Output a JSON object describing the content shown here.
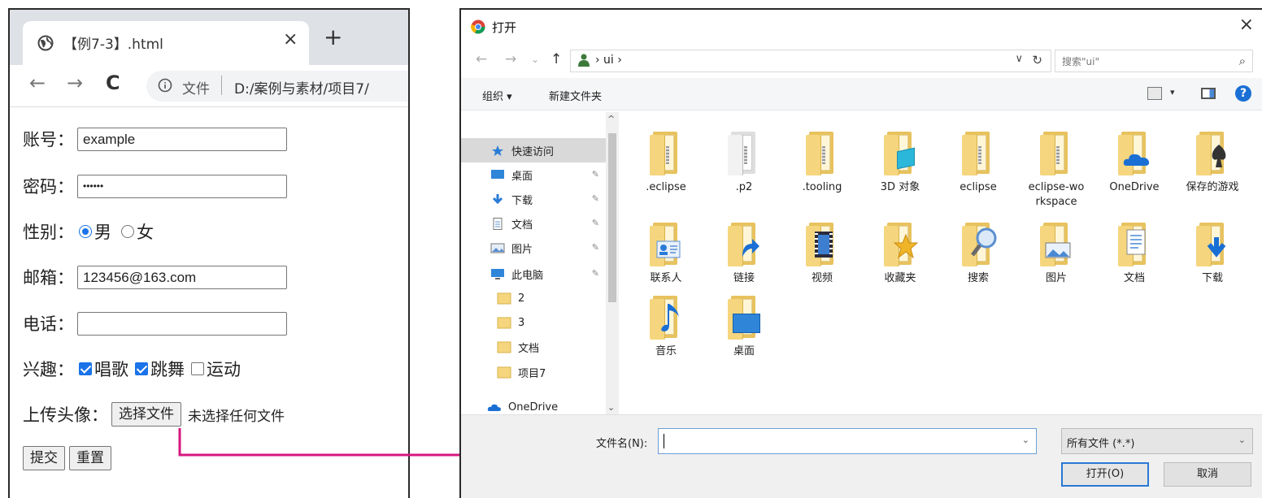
{
  "browser": {
    "tab_title": "【例7-3】.html",
    "tab_close": "×",
    "new_tab": "+",
    "nav": {
      "back": "←",
      "forward": "→",
      "reload": "C"
    },
    "address": {
      "scheme": "文件",
      "url": "D:/案例与素材/项目7/"
    }
  },
  "form": {
    "account": {
      "label": "账号：",
      "value": "example"
    },
    "password": {
      "label": "密码：",
      "value": "••••••"
    },
    "gender": {
      "label": "性别：",
      "options": [
        {
          "label": "男",
          "checked": true
        },
        {
          "label": "女",
          "checked": false
        }
      ]
    },
    "email": {
      "label": "邮箱：",
      "value": "123456@163.com"
    },
    "phone": {
      "label": "电话：",
      "value": ""
    },
    "hobby": {
      "label": "兴趣：",
      "options": [
        {
          "label": "唱歌",
          "checked": true
        },
        {
          "label": "跳舞",
          "checked": true
        },
        {
          "label": "运动",
          "checked": false
        }
      ]
    },
    "avatar": {
      "label": "上传头像：",
      "button": "选择文件",
      "status": "未选择任何文件"
    },
    "submit": "提交",
    "reset": "重置"
  },
  "dialog": {
    "title": "打开",
    "close": "×",
    "nav": {
      "back": "←",
      "forward": "→",
      "recent": "⌄",
      "up": "↑"
    },
    "breadcrumb": "› ui ›",
    "address_dropdown": "∨",
    "refresh": "↻",
    "search_placeholder": "搜索\"ui\"",
    "search_icon": "⌕",
    "toolbar": {
      "organize": "组织 ▾",
      "new_folder": "新建文件夹",
      "view_dropdown": "▾",
      "help": "?"
    },
    "nav_pane": [
      {
        "label": "快速访问",
        "icon": "star-icon",
        "selected": true,
        "pinned": false
      },
      {
        "label": "桌面",
        "icon": "desktop-icon",
        "selected": false,
        "pinned": true
      },
      {
        "label": "下载",
        "icon": "download-icon",
        "selected": false,
        "pinned": true
      },
      {
        "label": "文档",
        "icon": "document-icon",
        "selected": false,
        "pinned": true
      },
      {
        "label": "图片",
        "icon": "picture-icon",
        "selected": false,
        "pinned": true
      },
      {
        "label": "此电脑",
        "icon": "computer-icon",
        "selected": false,
        "pinned": true
      },
      {
        "label": "2",
        "icon": "folder-icon",
        "selected": false,
        "pinned": false
      },
      {
        "label": "3",
        "icon": "folder-icon",
        "selected": false,
        "pinned": false
      },
      {
        "label": "文档",
        "icon": "folder-icon",
        "selected": false,
        "pinned": false
      },
      {
        "label": "项目7",
        "icon": "folder-icon",
        "selected": false,
        "pinned": false
      },
      {
        "label": "OneDrive",
        "icon": "cloud-icon",
        "selected": false,
        "pinned": false
      }
    ],
    "scroll": {
      "up": "^",
      "down": "⌄"
    },
    "items": [
      {
        "label": ".eclipse",
        "icon": "folder-icon"
      },
      {
        "label": ".p2",
        "icon": "folder-icon"
      },
      {
        "label": ".tooling",
        "icon": "folder-icon"
      },
      {
        "label": "3D 对象",
        "icon": "3d-objects-folder-icon"
      },
      {
        "label": "eclipse",
        "icon": "folder-icon"
      },
      {
        "label": "eclipse-workspace",
        "icon": "folder-icon"
      },
      {
        "label": "OneDrive",
        "icon": "onedrive-folder-icon"
      },
      {
        "label": "保存的游戏",
        "icon": "saved-games-folder-icon"
      },
      {
        "label": "联系人",
        "icon": "contacts-folder-icon"
      },
      {
        "label": "链接",
        "icon": "links-folder-icon"
      },
      {
        "label": "视频",
        "icon": "videos-folder-icon"
      },
      {
        "label": "收藏夹",
        "icon": "favorites-folder-icon"
      },
      {
        "label": "搜索",
        "icon": "searches-folder-icon"
      },
      {
        "label": "图片",
        "icon": "pictures-folder-icon"
      },
      {
        "label": "文档",
        "icon": "documents-folder-icon"
      },
      {
        "label": "下载",
        "icon": "downloads-folder-icon"
      },
      {
        "label": "音乐",
        "icon": "music-folder-icon"
      },
      {
        "label": "桌面",
        "icon": "desktop-folder-icon"
      }
    ],
    "filename_label": "文件名(N):",
    "filename_value": "",
    "filetype": "所有文件 (*.*)",
    "dropdown": "⌄",
    "open_button": "打开(O)",
    "cancel_button": "取消"
  },
  "colors": {
    "arrow": "#d6177f",
    "accent": "#1a73e8",
    "folder": "#f5d67e"
  }
}
